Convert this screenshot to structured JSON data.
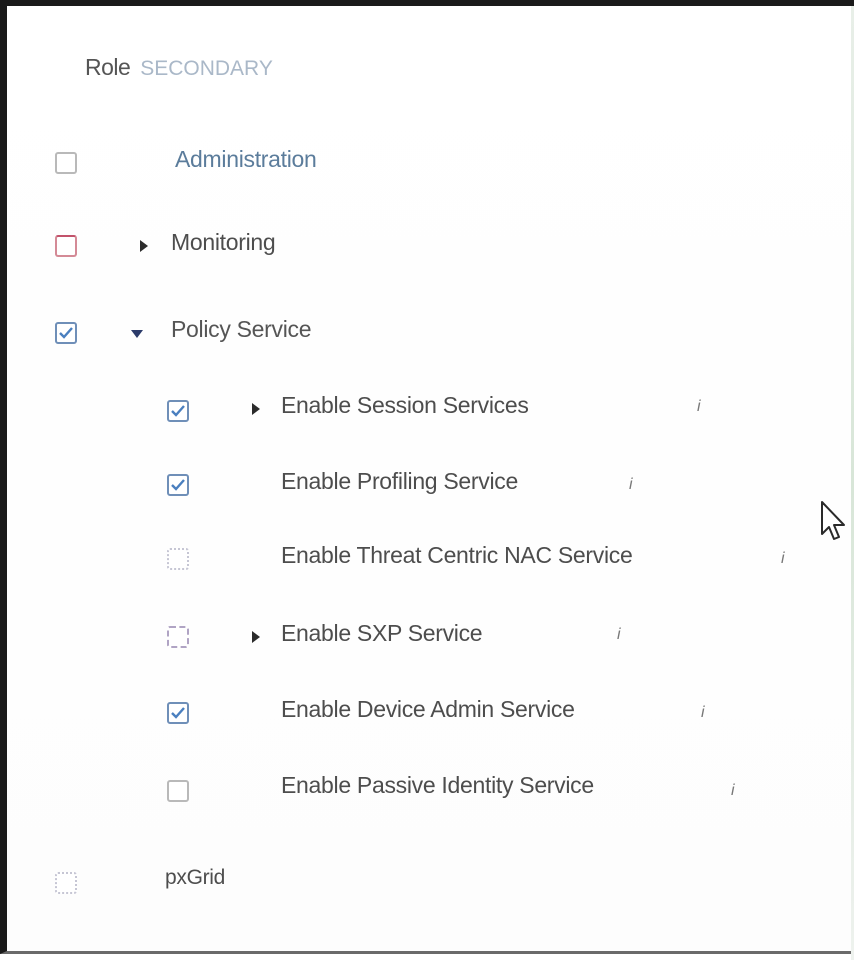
{
  "role": {
    "label": "Role",
    "value": "SECONDARY"
  },
  "personas": [
    {
      "label": "Administration",
      "checked": false
    },
    {
      "label": "Monitoring",
      "checked": false,
      "expandable": true
    },
    {
      "label": "Policy Service",
      "checked": true,
      "expanded": true
    },
    {
      "label": "pxGrid",
      "checked": false
    }
  ],
  "policy_services": [
    {
      "label": "Enable Session Services",
      "checked": true,
      "expandable": true
    },
    {
      "label": "Enable Profiling Service",
      "checked": true
    },
    {
      "label": "Enable Threat Centric NAC Service",
      "checked": false
    },
    {
      "label": "Enable SXP Service",
      "checked": false,
      "expandable": true
    },
    {
      "label": "Enable Device Admin Service",
      "checked": true
    },
    {
      "label": "Enable Passive Identity Service",
      "checked": false
    }
  ],
  "icons": {
    "checkbox_checked": "check-icon",
    "info": "info-icon",
    "expand": "caret-right-icon",
    "collapse": "caret-down-icon",
    "cursor": "mouse-pointer-icon"
  },
  "colors": {
    "checkbox_checked_border": "#6f8fb8",
    "checkmark": "#4a7fbf",
    "text": "#4d4d4d"
  }
}
